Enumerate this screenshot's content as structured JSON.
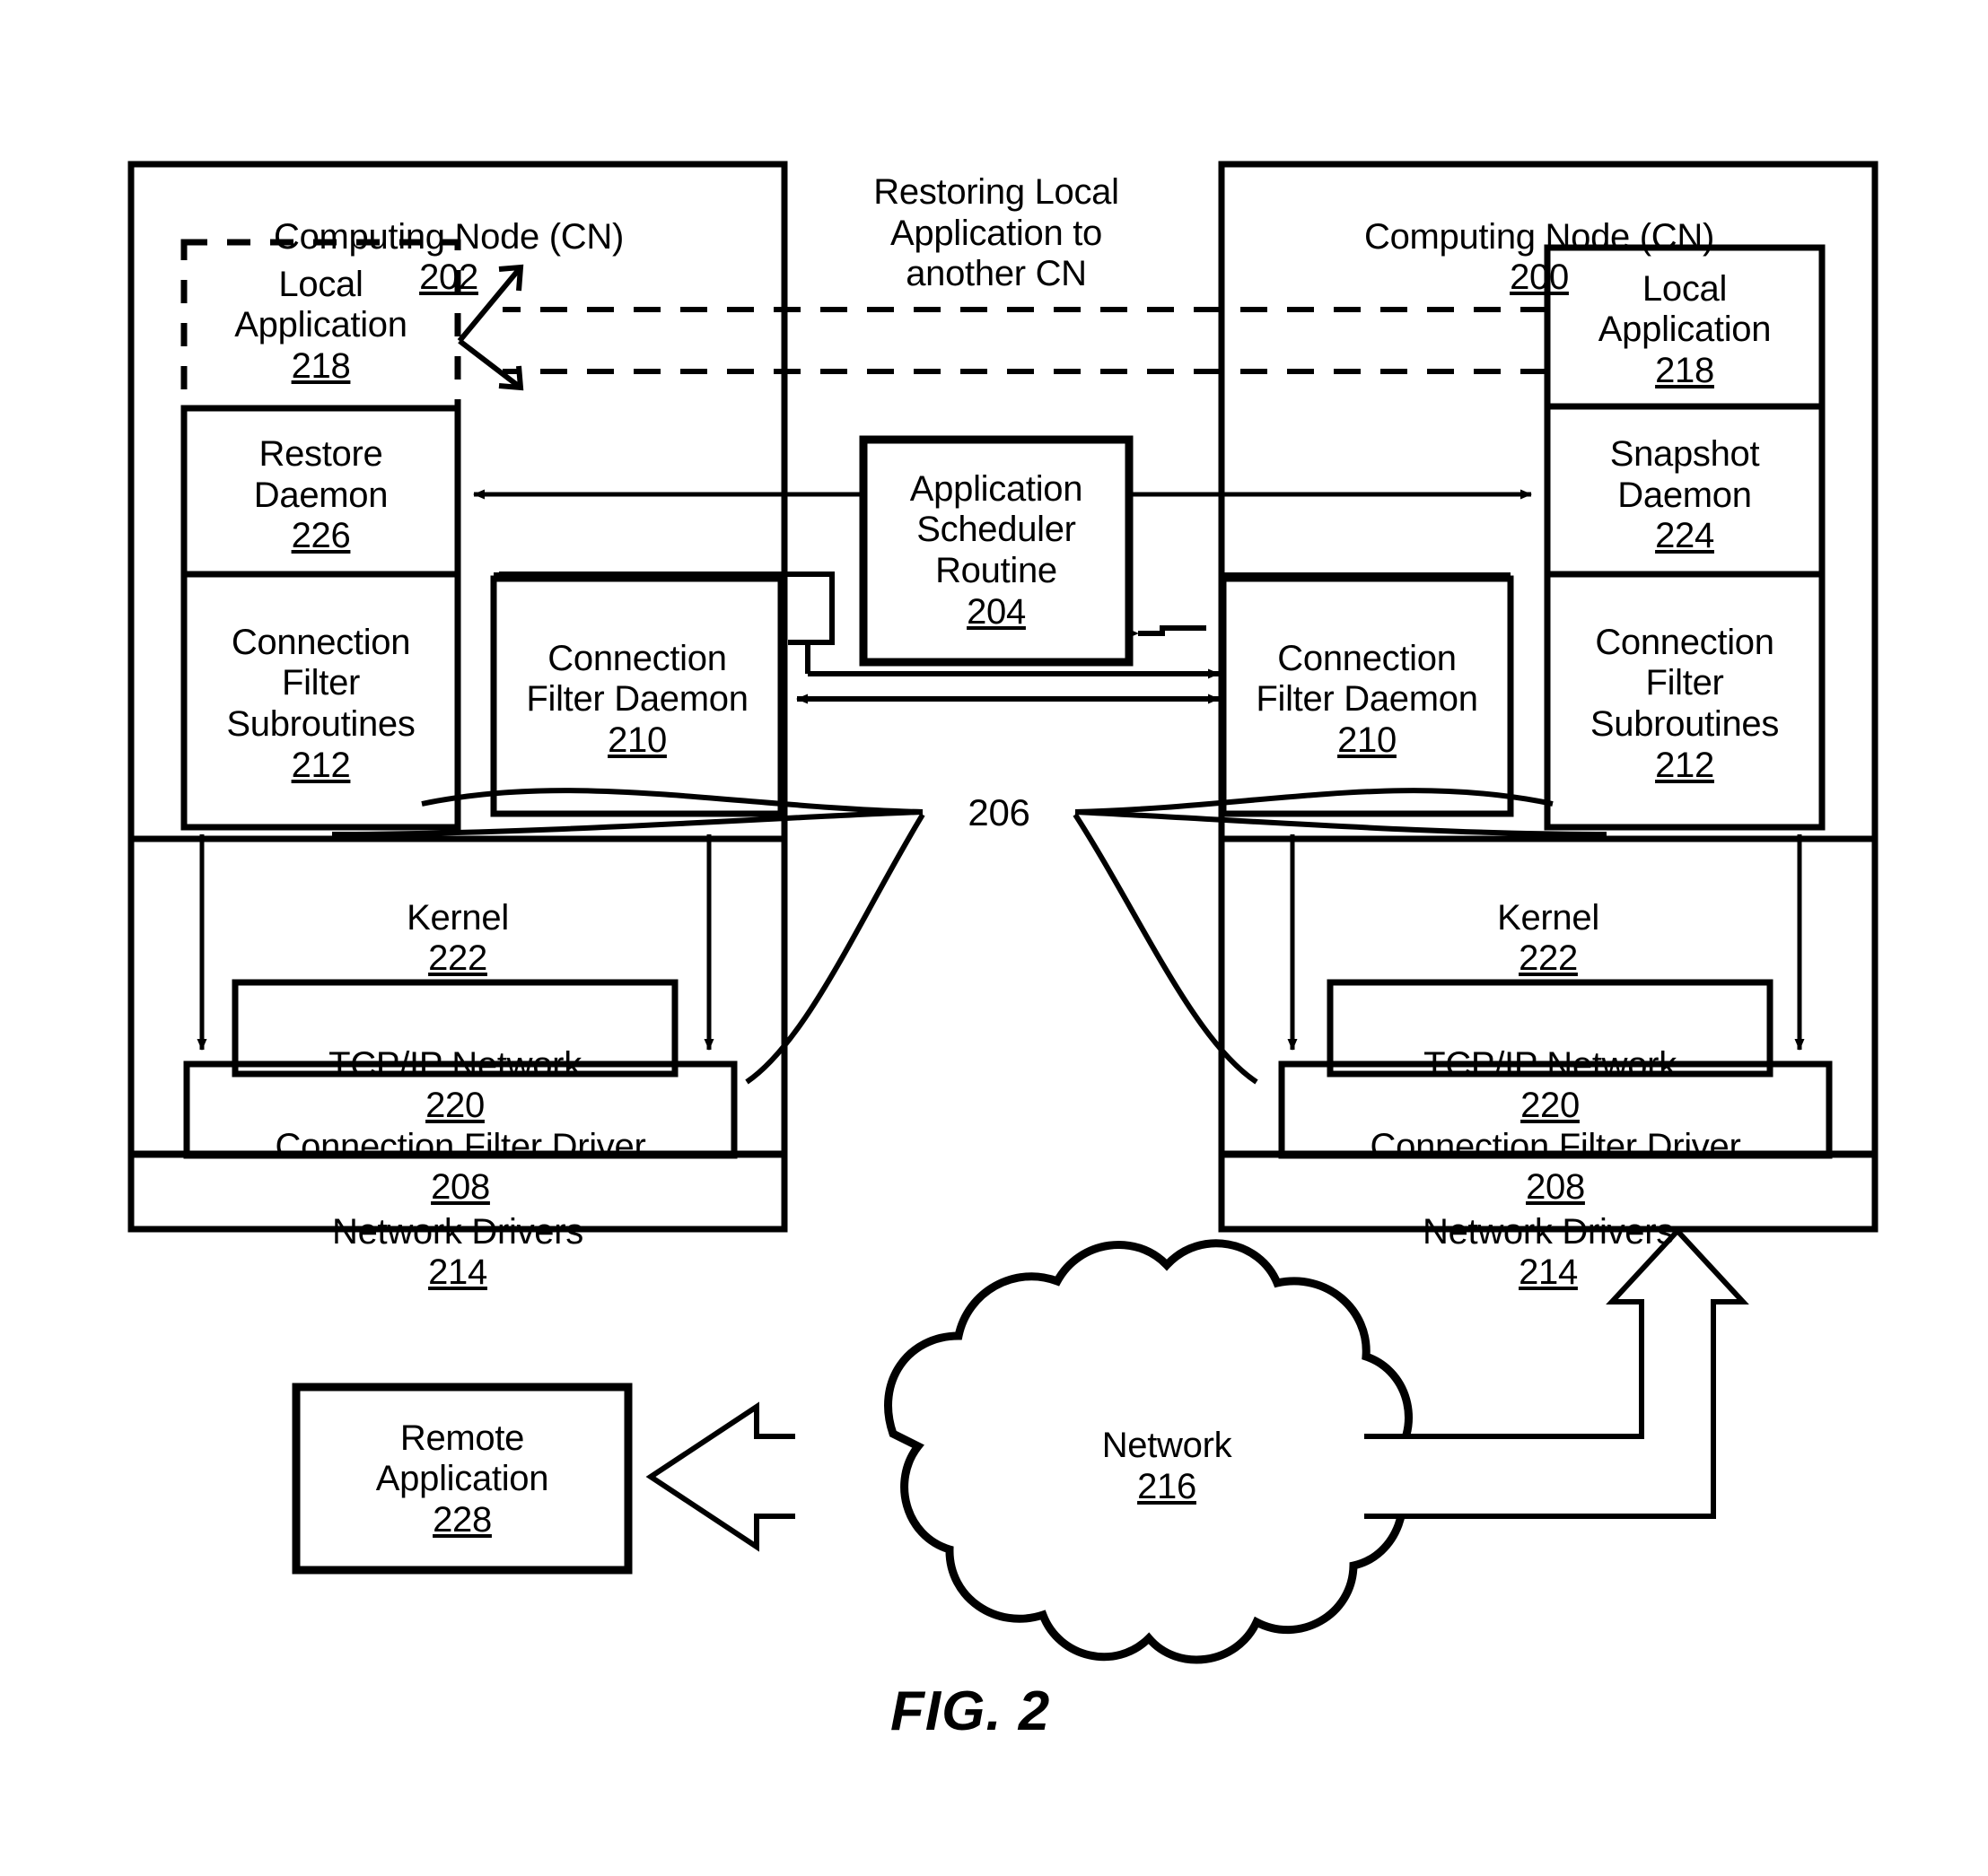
{
  "figure": {
    "label": "FIG. 2",
    "caption_center": "Restoring Local\nApplication to\nanother CN"
  },
  "nodes": {
    "left": {
      "title_text": "Computing Node (CN)",
      "title_ref": "202",
      "blocks": {
        "local_application": {
          "text": "Local\nApplication",
          "ref": "218",
          "style": "dashed"
        },
        "restore_daemon": {
          "text": "Restore\nDaemon",
          "ref": "226"
        },
        "connection_filter_subroutines": {
          "text": "Connection\nFilter\nSubroutines",
          "ref": "212"
        },
        "connection_filter_daemon": {
          "text": "Connection\nFilter Daemon",
          "ref": "210"
        },
        "kernel": {
          "text": "Kernel",
          "ref": "222"
        },
        "tcp_ip_network": {
          "text": "TCP/IP Network",
          "ref": "220"
        },
        "connection_filter_driver": {
          "text": "Connection Filter Driver",
          "ref": "208"
        },
        "network_drivers": {
          "text": "Network Drivers",
          "ref": "214"
        }
      }
    },
    "right": {
      "title_text": "Computing Node (CN)",
      "title_ref": "200",
      "blocks": {
        "local_application": {
          "text": "Local\nApplication",
          "ref": "218"
        },
        "snapshot_daemon": {
          "text": "Snapshot\nDaemon",
          "ref": "224"
        },
        "connection_filter_subroutines": {
          "text": "Connection\nFilter\nSubroutines",
          "ref": "212"
        },
        "connection_filter_daemon": {
          "text": "Connection\nFilter Daemon",
          "ref": "210"
        },
        "kernel": {
          "text": "Kernel",
          "ref": "222"
        },
        "tcp_ip_network": {
          "text": "TCP/IP Network",
          "ref": "220"
        },
        "connection_filter_driver": {
          "text": "Connection Filter Driver",
          "ref": "208"
        },
        "network_drivers": {
          "text": "Network Drivers",
          "ref": "214"
        }
      }
    }
  },
  "center": {
    "application_scheduler_routine": {
      "text": "Application\nScheduler\nRoutine",
      "ref": "204"
    },
    "connection_ref": "206"
  },
  "bottom": {
    "remote_application": {
      "text": "Remote\nApplication",
      "ref": "228"
    },
    "network_cloud": {
      "text": "Network",
      "ref": "216"
    }
  },
  "colors": {
    "stroke": "#000000",
    "background": "#ffffff"
  }
}
